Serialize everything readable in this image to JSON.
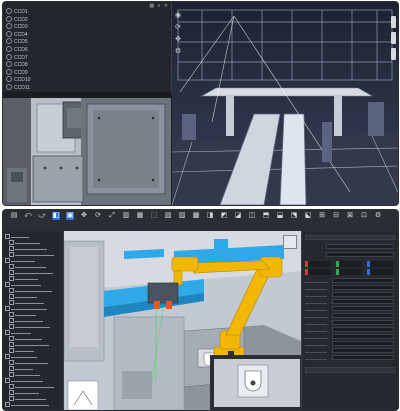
{
  "top": {
    "list": {
      "items": [
        "CCD1",
        "CCD2",
        "CCD3",
        "CCD4",
        "CCD5",
        "CCD6",
        "CCD7",
        "CCD8",
        "CCD9",
        "CCD10",
        "CCD11"
      ],
      "toolbar_icons": [
        "grid-icon",
        "list-icon",
        "close-icon"
      ]
    },
    "right_view": {
      "tools": [
        "eye-icon",
        "rotate-icon",
        "move-icon",
        "settings-icon"
      ]
    }
  },
  "bottom": {
    "tree_rows": [
      "",
      "",
      "",
      "",
      "",
      "",
      "",
      "",
      "",
      "",
      "",
      "",
      "",
      "",
      "",
      "",
      "",
      "",
      "",
      "",
      "",
      "",
      "",
      "",
      "",
      "",
      "",
      "",
      ""
    ],
    "right_panel": {
      "coord_colors": [
        "#d23c3c",
        "#3aa655",
        "#2e6ed6"
      ]
    }
  },
  "colors": {
    "robot": "#f2b705",
    "conveyor": "#2fa8e8",
    "accent": "#2e6ed6",
    "panel": "#24272d"
  }
}
